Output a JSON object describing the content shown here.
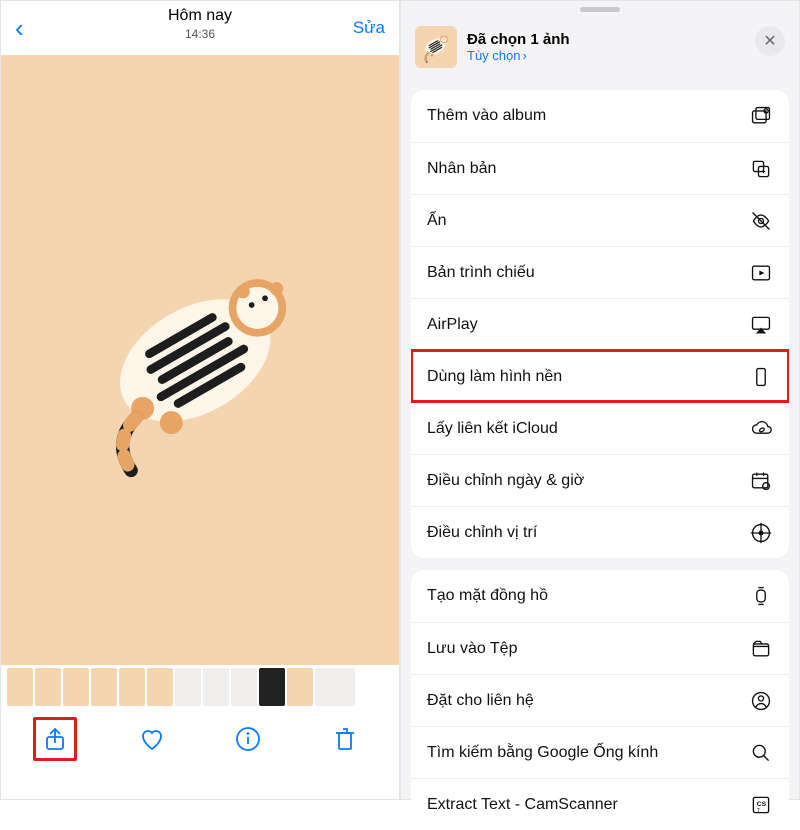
{
  "left": {
    "title": "Hôm nay",
    "time": "14:36",
    "edit": "Sửa"
  },
  "right": {
    "selected": "Đã chọn 1 ảnh",
    "options": "Tùy chọn",
    "group1": [
      {
        "label": "Thêm vào album",
        "icon": "album-add-icon"
      },
      {
        "label": "Nhân bản",
        "icon": "duplicate-icon"
      },
      {
        "label": "Ẩn",
        "icon": "hide-icon"
      },
      {
        "label": "Bản trình chiếu",
        "icon": "slideshow-icon"
      },
      {
        "label": "AirPlay",
        "icon": "airplay-icon"
      },
      {
        "label": "Dùng làm hình nền",
        "icon": "wallpaper-icon",
        "highlight": true
      },
      {
        "label": "Lấy liên kết iCloud",
        "icon": "icloud-link-icon"
      },
      {
        "label": "Điều chỉnh ngày & giờ",
        "icon": "datetime-icon"
      },
      {
        "label": "Điều chỉnh vị trí",
        "icon": "location-icon"
      }
    ],
    "group2": [
      {
        "label": "Tạo mặt đồng hồ",
        "icon": "watchface-icon"
      },
      {
        "label": "Lưu vào Tệp",
        "icon": "files-icon"
      },
      {
        "label": "Đặt cho liên hệ",
        "icon": "contact-icon"
      },
      {
        "label": "Tìm kiếm bằng Google Ống kính",
        "icon": "search-icon"
      },
      {
        "label": "Extract Text - CamScanner",
        "icon": "ocr-icon"
      }
    ]
  }
}
